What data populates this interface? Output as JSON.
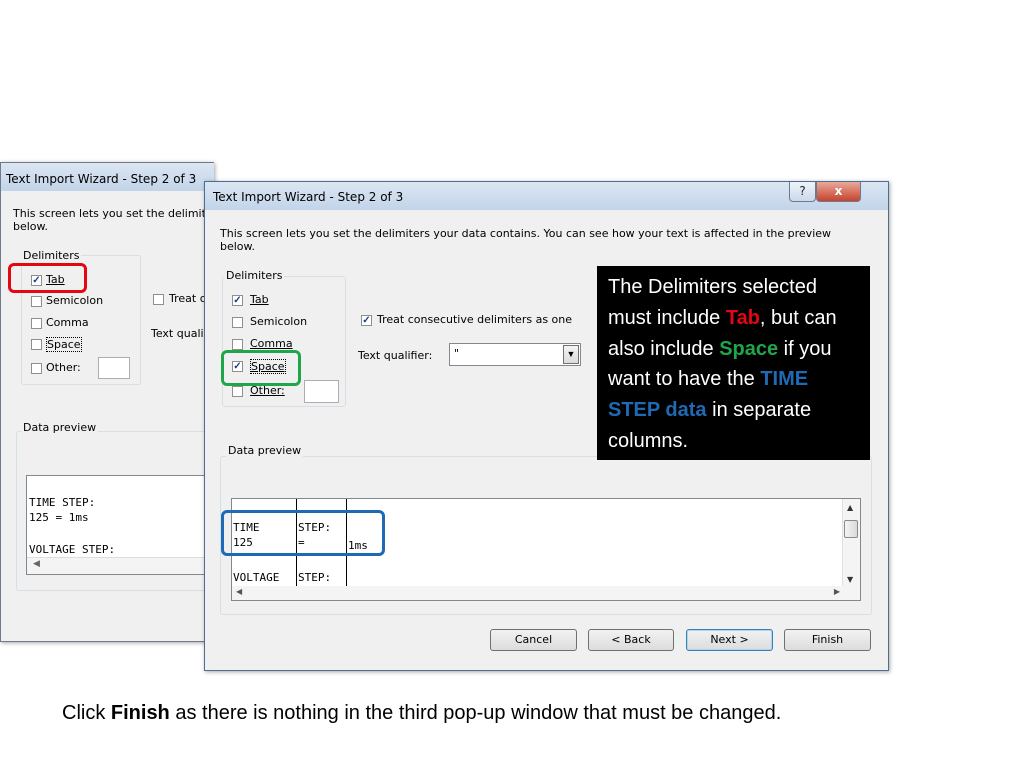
{
  "back_window": {
    "title": "Text Import Wizard - Step 2 of 3",
    "desc_line1": "This screen lets you set the delimit",
    "desc_line2": "below.",
    "delimiters_label": "Delimiters",
    "tab_label": "Tab",
    "semicolon_label": "Semicolon",
    "comma_label": "Comma",
    "space_label": "Space",
    "other_label": "Other:",
    "treat_label": "Treat c",
    "qualifier_label": "Text quali",
    "preview_label": "Data preview",
    "preview_lines": [
      "TIME STEP:",
      "125 = 1ms",
      "",
      "VOLTAGE STEP:"
    ]
  },
  "front_window": {
    "title": "Text Import Wizard - Step 2 of 3",
    "help_button": "?",
    "close_button": "x",
    "desc_line1": "This screen lets you set the delimiters your data contains.  You can see how your text is affected in the preview",
    "desc_line2": "below.",
    "delimiters_label": "Delimiters",
    "tab_label": "Tab",
    "semicolon_label": "Semicolon",
    "comma_label": "Comma",
    "space_label": "Space",
    "other_label": "Other:",
    "treat_label": "Treat consecutive delimiters as one",
    "qualifier_label": "Text qualifier:",
    "qualifier_value": "\"",
    "preview_label": "Data preview",
    "preview_rows": [
      [
        "TIME",
        "STEP:",
        ""
      ],
      [
        "125",
        "=",
        "1ms"
      ],
      [
        "",
        "",
        ""
      ],
      [
        "VOLTAGE",
        "STEP:",
        ""
      ]
    ],
    "buttons": {
      "cancel": "Cancel",
      "back": "< Back",
      "next": "Next >",
      "finish": "Finish"
    },
    "checked": {
      "tab": true,
      "semicolon": false,
      "comma": false,
      "space": true,
      "other": false,
      "treat": true
    }
  },
  "callout": {
    "part1": "The Delimiters selected must include ",
    "tab_word": "Tab",
    "part2": ", but can also include ",
    "space_word": "Space",
    "part3": " if you want to have the ",
    "timestep_word": "TIME STEP data",
    "part4": " in separate columns."
  },
  "caption": {
    "prefix": "Click ",
    "bold": "Finish",
    "suffix": " as there is nothing in the third pop-up window that must be changed."
  },
  "colors": {
    "tab_highlight": "#e30613",
    "space_highlight": "#1fa64a",
    "timestep_highlight": "#1f6ab5"
  }
}
